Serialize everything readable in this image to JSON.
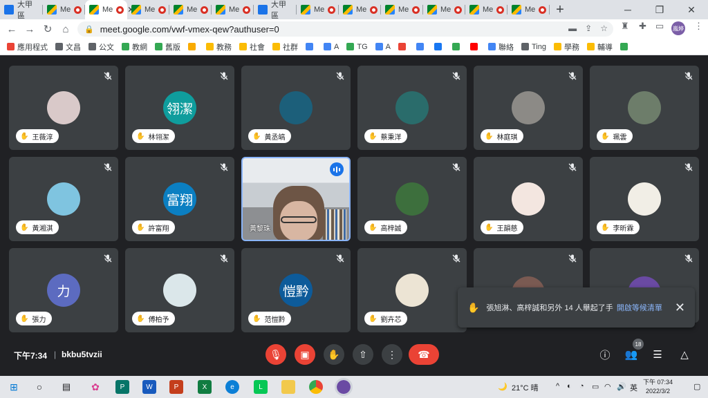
{
  "browser": {
    "tabs": [
      {
        "label": "大甲區",
        "icon": "calendar-icon",
        "active": false
      },
      {
        "label": "Me",
        "icon": "meet-icon",
        "recording": true
      },
      {
        "label": "Me",
        "icon": "meet-icon",
        "recording": true,
        "active": true
      },
      {
        "label": "Me",
        "icon": "meet-icon",
        "recording": true
      },
      {
        "label": "Me",
        "icon": "meet-icon",
        "recording": true
      },
      {
        "label": "Me",
        "icon": "meet-icon",
        "recording": true
      },
      {
        "label": "大甲區",
        "icon": "calendar-icon",
        "recording": false
      },
      {
        "label": "Me",
        "icon": "meet-icon",
        "recording": true
      },
      {
        "label": "Me",
        "icon": "meet-icon",
        "recording": true
      },
      {
        "label": "Me",
        "icon": "meet-icon",
        "recording": true
      },
      {
        "label": "Me",
        "icon": "meet-icon",
        "recording": true
      },
      {
        "label": "Me",
        "icon": "meet-icon",
        "recording": true
      },
      {
        "label": "Me",
        "icon": "meet-icon",
        "recording": true
      }
    ],
    "active_tab_close": "✕",
    "new_tab": "+",
    "url": "meet.google.com/vwf-vmex-qew?authuser=0",
    "profile": "嵐婷",
    "bookmarks": [
      {
        "label": "應用程式",
        "icon": "apps-icon",
        "color": "#ea4335"
      },
      {
        "label": "文昌",
        "icon": "page-icon",
        "color": "#5f6368"
      },
      {
        "label": "公文",
        "icon": "globe-icon",
        "color": "#5f6368"
      },
      {
        "label": "教網",
        "icon": "chrome-icon",
        "color": "#34a853"
      },
      {
        "label": "舊版",
        "icon": "chrome-icon",
        "color": "#34a853"
      },
      {
        "label": "",
        "icon": "ext-icon",
        "color": "#f9ab00"
      },
      {
        "label": "教務",
        "icon": "folder-icon",
        "color": "#fbbc04"
      },
      {
        "label": "社會",
        "icon": "folder-icon",
        "color": "#fbbc04"
      },
      {
        "label": "社群",
        "icon": "folder-icon",
        "color": "#fbbc04"
      },
      {
        "label": "",
        "icon": "google-icon",
        "color": "#4285f4"
      },
      {
        "label": "A",
        "icon": "google-icon",
        "color": "#4285f4"
      },
      {
        "label": "TG",
        "icon": "drive-icon",
        "color": "#34a853"
      },
      {
        "label": "A",
        "icon": "google-icon",
        "color": "#4285f4"
      },
      {
        "label": "",
        "icon": "photos-icon",
        "color": "#ea4335"
      },
      {
        "label": "",
        "icon": "calendar-icon",
        "color": "#4285f4"
      },
      {
        "label": "",
        "icon": "facebook-icon",
        "color": "#1877f2"
      },
      {
        "label": "",
        "icon": "ext-icon",
        "color": "#34a853"
      },
      {
        "label": "",
        "icon": "youtube-icon",
        "color": "#ff0000"
      },
      {
        "label": "聯絡",
        "icon": "google-icon",
        "color": "#4285f4"
      },
      {
        "label": "Ting",
        "icon": "page-icon",
        "color": "#5f6368"
      },
      {
        "label": "學務",
        "icon": "folder-icon",
        "color": "#fbbc04"
      },
      {
        "label": "輔導",
        "icon": "folder-icon",
        "color": "#fbbc04"
      },
      {
        "label": "",
        "icon": "ext-icon",
        "color": "#34a853"
      }
    ]
  },
  "meet": {
    "tiles": [
      {
        "name": "王薇淳",
        "avatar_text": "",
        "avatar_color": "#d9c9c9",
        "kind": "photo"
      },
      {
        "name": "林翎潔",
        "avatar_text": "翎潔",
        "avatar_color": "#0f9d9d",
        "kind": "initials"
      },
      {
        "name": "黃丞皜",
        "avatar_text": "",
        "avatar_color": "#1c5f7a",
        "kind": "photo"
      },
      {
        "name": "蔡秉洋",
        "avatar_text": "",
        "avatar_color": "#2a6c6b",
        "kind": "photo"
      },
      {
        "name": "林庭琪",
        "avatar_text": "",
        "avatar_color": "#8c8a86",
        "kind": "photo"
      },
      {
        "name": "珮雲",
        "avatar_text": "",
        "avatar_color": "#6d7d6a",
        "kind": "photo"
      },
      {
        "name": "黃湘淇",
        "avatar_text": "",
        "avatar_color": "#7fc4e0",
        "kind": "photo"
      },
      {
        "name": "許富翔",
        "avatar_text": "富翔",
        "avatar_color": "#0b7fc2",
        "kind": "initials"
      },
      {
        "name": "黃黎珠",
        "avatar_text": "",
        "avatar_color": "#a9b4bb",
        "kind": "video"
      },
      {
        "name": "高梓誠",
        "avatar_text": "",
        "avatar_color": "#3d6f3d",
        "kind": "photo"
      },
      {
        "name": "王韻慈",
        "avatar_text": "",
        "avatar_color": "#f3e6e0",
        "kind": "photo"
      },
      {
        "name": "李昕霖",
        "avatar_text": "",
        "avatar_color": "#f1eee6",
        "kind": "photo"
      },
      {
        "name": "張力",
        "avatar_text": "力",
        "avatar_color": "#5c6bc0",
        "kind": "initials"
      },
      {
        "name": "傅柏予",
        "avatar_text": "",
        "avatar_color": "#dbe7ea",
        "kind": "photo"
      },
      {
        "name": "范愷黔",
        "avatar_text": "愷黔",
        "avatar_color": "#0d5b9a",
        "kind": "initials"
      },
      {
        "name": "劉卉芯",
        "avatar_text": "",
        "avatar_color": "#ece4d4",
        "kind": "photo"
      },
      {
        "name": "",
        "avatar_text": "旭淋",
        "avatar_color": "#7a5a52",
        "kind": "initials"
      },
      {
        "name": "",
        "avatar_text": "嵐婷",
        "avatar_color": "#6a4aa3",
        "kind": "initials"
      }
    ],
    "toast": {
      "text": "張旭淋、高梓誠和另外 14 人舉起了手",
      "link": "開啟等候清單"
    },
    "bottom": {
      "time": "下午7:34",
      "separator": "|",
      "meeting_code": "bkbu5tvzii",
      "participant_count": "18"
    }
  },
  "taskbar": {
    "weather": "21°C 晴",
    "ime": "英",
    "time": "下午 07:34",
    "date": "2022/3/2"
  },
  "colors": {
    "meet_bg": "#202124",
    "tile_bg": "#3c4043",
    "accent_blue": "#8ab4f8",
    "hangup_red": "#ea4335"
  }
}
